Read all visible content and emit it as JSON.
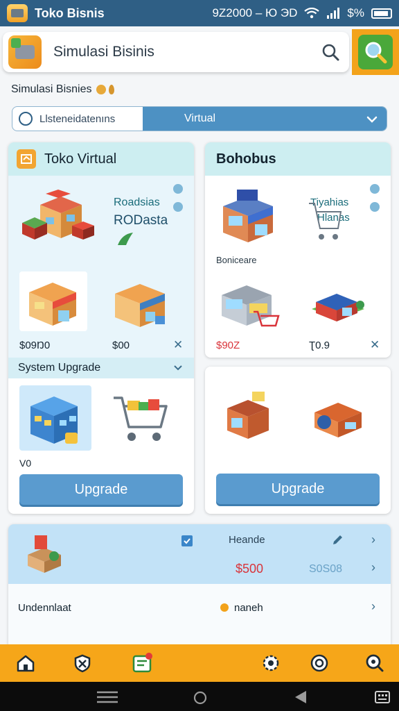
{
  "status_bar": {
    "app_title": "Toko Bisnis",
    "clock": "9Z2000 – Ю ЭD",
    "battery": "$%"
  },
  "search": {
    "value": "Simulasi Bisinis"
  },
  "section": {
    "title": "Simulasi Bisnies"
  },
  "segment": {
    "left_label": "Llsteneidatenıns",
    "right_label": "Virtual"
  },
  "card_left": {
    "title": "Toko Virtual",
    "side_text_1": "Roadsias",
    "side_text_2": "RODasta",
    "price_1": "$09Ŋ0",
    "price_2": "$00",
    "upgrade_section_label": "System Upgrade",
    "level_label": "V0",
    "upgrade_button": "Upgrade"
  },
  "card_right": {
    "title": "Bohobus",
    "side_text_1": "Tiyahias",
    "side_text_2": "Hlanas",
    "caption": "Boniceare",
    "price_1": "$90Z",
    "price_2": "Ʈ0.9",
    "upgrade_button": "Upgrade"
  },
  "panel": {
    "label_top": "Heande",
    "price_red": "$500",
    "price_blue": "S0S08",
    "row_label": "Undennlaat",
    "status_label": "naneh"
  },
  "colors": {
    "status_bar": "#2f5f85",
    "accent_orange": "#f6a619",
    "button_blue": "#5a9bcf",
    "card_header": "#cdeef1",
    "price_red": "#d9343a"
  }
}
